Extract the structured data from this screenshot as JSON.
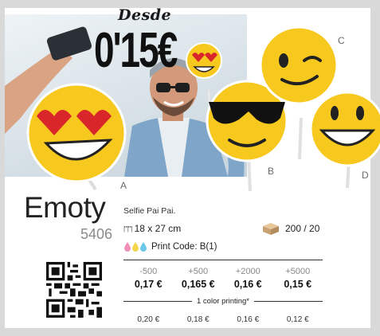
{
  "promo": {
    "from_label": "Desde",
    "price": "0'15€"
  },
  "product": {
    "name": "Emoty",
    "ref": "5406",
    "description": "Selfie Pai Pai.",
    "size": "18 x 27 cm",
    "packing": "200 / 20",
    "print_code": "Print Code: B(1)"
  },
  "variants": [
    "A",
    "B",
    "C",
    "D"
  ],
  "pricing": {
    "quantities": [
      "-500",
      "+500",
      "+2000",
      "+5000"
    ],
    "prices": [
      "0,17 €",
      "0,165 €",
      "0,16 €",
      "0,15 €"
    ],
    "color_label": "1 color printing*",
    "color_prices": [
      "0,20 €",
      "0,18 €",
      "0,16 €",
      "0,12 €"
    ]
  },
  "colors": {
    "emoji_yellow": "#f7c81e",
    "heart_red": "#d9262b",
    "dark": "#111111"
  },
  "icons": [
    "ruler-icon",
    "box-icon",
    "ink-drops-icon",
    "qr-code"
  ]
}
